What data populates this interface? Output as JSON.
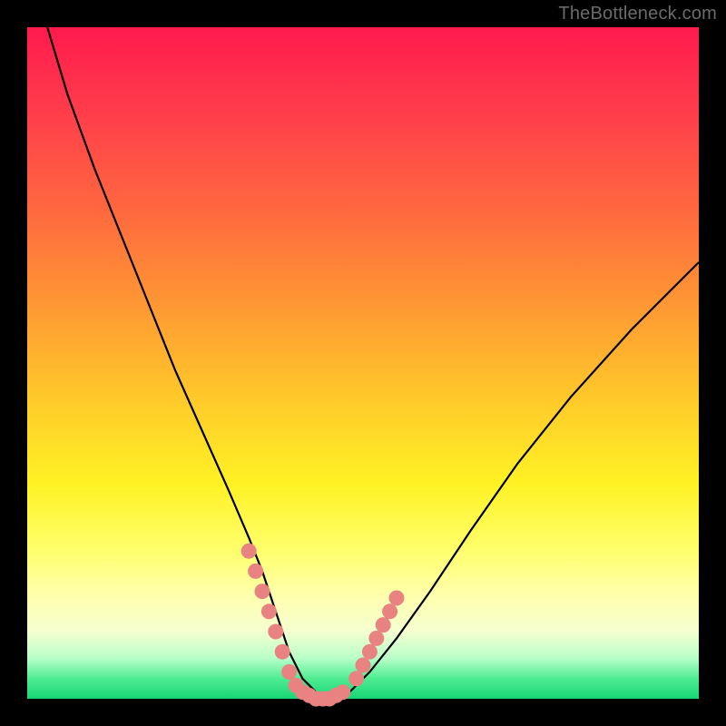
{
  "watermark": "TheBottleneck.com",
  "colors": {
    "background": "#000000",
    "curve": "#000000",
    "highlight": "#e98382"
  },
  "chart_data": {
    "type": "line",
    "title": "",
    "xlabel": "",
    "ylabel": "",
    "xlim": [
      0,
      100
    ],
    "ylim": [
      0,
      100
    ],
    "grid": false,
    "legend": false,
    "series": [
      {
        "name": "bottleneck-curve",
        "x": [
          3,
          6,
          10,
          14,
          18,
          22,
          26,
          30,
          33,
          35,
          36,
          37,
          38,
          39,
          40,
          41,
          42,
          43,
          44,
          46,
          48,
          51,
          55,
          60,
          66,
          73,
          81,
          90,
          100
        ],
        "values": [
          100,
          90,
          79,
          69,
          59,
          49,
          40,
          31,
          24,
          19,
          16,
          13,
          10,
          7,
          5,
          3,
          2,
          1,
          0,
          0,
          1,
          4,
          9,
          16,
          25,
          35,
          45,
          55,
          65
        ]
      }
    ],
    "highlights": {
      "name": "dotted-highlight",
      "point_groups": [
        {
          "x": [
            33,
            34,
            35,
            36,
            37,
            38,
            39
          ],
          "values": [
            22,
            19,
            16,
            13,
            10,
            7,
            4
          ]
        },
        {
          "x": [
            40,
            41,
            42,
            43,
            44,
            45,
            46,
            47
          ],
          "values": [
            2,
            1,
            0.5,
            0,
            0,
            0,
            0.5,
            1
          ]
        },
        {
          "x": [
            49,
            50,
            51,
            52,
            53,
            54,
            55
          ],
          "values": [
            3,
            5,
            7,
            9,
            11,
            13,
            15
          ]
        }
      ]
    }
  }
}
